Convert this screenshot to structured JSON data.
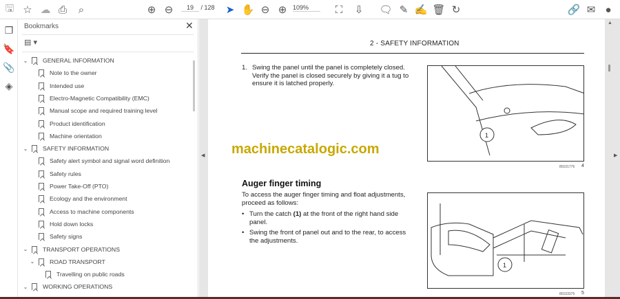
{
  "toolbar": {
    "page_current": "19",
    "page_total": "/ 128",
    "zoom": "109%",
    "icons": [
      "save-icon",
      "star-icon",
      "cloud-upload-icon",
      "print-icon",
      "find-icon",
      "page-up-icon",
      "page-down-icon",
      "select-cursor-icon",
      "hand-icon",
      "zoom-out-icon",
      "zoom-in-icon",
      "fit-page-icon",
      "scroll-mode-icon",
      "comment-icon",
      "highlight-icon",
      "sign-icon",
      "delete-icon",
      "rotate-icon",
      "share-link-icon",
      "email-icon",
      "account-icon"
    ]
  },
  "sidebar": {
    "title": "Bookmarks",
    "close": "✕",
    "options": "▤ ▾",
    "items": [
      {
        "label": "GENERAL INFORMATION",
        "level": 0,
        "expanded": true
      },
      {
        "label": "Note to the owner",
        "level": 1
      },
      {
        "label": "Intended use",
        "level": 1
      },
      {
        "label": "Electro-Magnetic Compatibility (EMC)",
        "level": 1
      },
      {
        "label": "Manual scope and required training level",
        "level": 1
      },
      {
        "label": "Product identification",
        "level": 1
      },
      {
        "label": "Machine orientation",
        "level": 1
      },
      {
        "label": "SAFETY INFORMATION",
        "level": 0,
        "expanded": true
      },
      {
        "label": "Safety alert symbol and signal word definition",
        "level": 1
      },
      {
        "label": "Safety rules",
        "level": 1
      },
      {
        "label": "Power Take-Off (PTO)",
        "level": 1
      },
      {
        "label": "Ecology and the environment",
        "level": 1
      },
      {
        "label": "Access to machine components",
        "level": 1
      },
      {
        "label": "Hold down locks",
        "level": 1
      },
      {
        "label": "Safety signs",
        "level": 1
      },
      {
        "label": "TRANSPORT OPERATIONS",
        "level": 0,
        "expanded": true
      },
      {
        "label": "ROAD TRANSPORT",
        "level": 1,
        "expanded": true
      },
      {
        "label": "Travelling on public roads",
        "level": 2
      },
      {
        "label": "WORKING OPERATIONS",
        "level": 0,
        "expanded": true
      }
    ]
  },
  "document": {
    "header": "2 - SAFETY INFORMATION",
    "step1_num": "1.",
    "step1": "Swing the panel until the panel is completely closed. Verify the panel is closed securely by giving it a tug to ensure it is latched properly.",
    "watermark": "machinecatalogic.com",
    "section_title": "Auger finger timing",
    "intro": "To access the auger finger timing and float adjustments, proceed as follows:",
    "bullets": [
      {
        "pre": "Turn the catch ",
        "bold": "(1)",
        "post": " at the front of the right hand side panel."
      },
      {
        "pre": "Swing the front of panel out and to the rear, to access the adjustments.",
        "bold": "",
        "post": ""
      }
    ],
    "figures": [
      {
        "code": "80101776",
        "num": "4",
        "callout": "1"
      },
      {
        "code": "80103375",
        "num": "5",
        "callout": "1"
      }
    ]
  }
}
